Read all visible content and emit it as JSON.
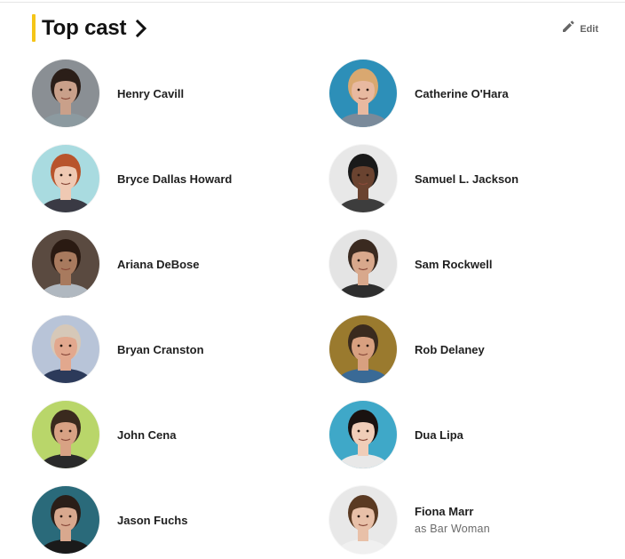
{
  "section": {
    "title": "Top cast",
    "edit_label": "Edit",
    "accent_color": "#f5c518",
    "title_icon": "chevron-right-icon",
    "edit_icon": "pencil-icon"
  },
  "cast": [
    {
      "name": "Henry Cavill",
      "character": "",
      "avatar_bg": "#8a8f94",
      "skin": "#c9a08a",
      "hair": "#2b1e18",
      "shirt": "#8c9aa0"
    },
    {
      "name": "Catherine O'Hara",
      "character": "",
      "avatar_bg": "#2d8fb8",
      "skin": "#e8b9a0",
      "hair": "#d9a870",
      "shirt": "#7a8a9a"
    },
    {
      "name": "Bryce Dallas Howard",
      "character": "",
      "avatar_bg": "#a9dbe0",
      "skin": "#efc9b3",
      "hair": "#b8542c",
      "shirt": "#3a3a44"
    },
    {
      "name": "Samuel L. Jackson",
      "character": "",
      "avatar_bg": "#e8e8e8",
      "skin": "#6a4330",
      "hair": "#1a1a1a",
      "shirt": "#3d3d3d"
    },
    {
      "name": "Ariana DeBose",
      "character": "",
      "avatar_bg": "#5a4a40",
      "skin": "#a87a5e",
      "hair": "#2a1a12",
      "shirt": "#b0b8c0"
    },
    {
      "name": "Sam Rockwell",
      "character": "",
      "avatar_bg": "#e4e4e4",
      "skin": "#d8a88c",
      "hair": "#3a2a20",
      "shirt": "#2e2e2e"
    },
    {
      "name": "Bryan Cranston",
      "character": "",
      "avatar_bg": "#b8c4d8",
      "skin": "#e2a88e",
      "hair": "#d6c8b8",
      "shirt": "#2c3a5a"
    },
    {
      "name": "Rob Delaney",
      "character": "",
      "avatar_bg": "#9a7a2e",
      "skin": "#d8a080",
      "hair": "#3a2a1e",
      "shirt": "#3a6a96"
    },
    {
      "name": "John Cena",
      "character": "",
      "avatar_bg": "#b9d66a",
      "skin": "#d8a284",
      "hair": "#3a2a1e",
      "shirt": "#2a2a2a"
    },
    {
      "name": "Dua Lipa",
      "character": "",
      "avatar_bg": "#3fa8c8",
      "skin": "#f0cdb8",
      "hair": "#1a1210",
      "shirt": "#e8e8e8"
    },
    {
      "name": "Jason Fuchs",
      "character": "",
      "avatar_bg": "#2a6a7a",
      "skin": "#d8a88e",
      "hair": "#2a1e18",
      "shirt": "#1a1a1a"
    },
    {
      "name": "Fiona Marr",
      "character": "as Bar Woman",
      "avatar_bg": "#e8e8e8",
      "skin": "#e8c0a8",
      "hair": "#5a3a22",
      "shirt": "#f0f0f0"
    }
  ]
}
